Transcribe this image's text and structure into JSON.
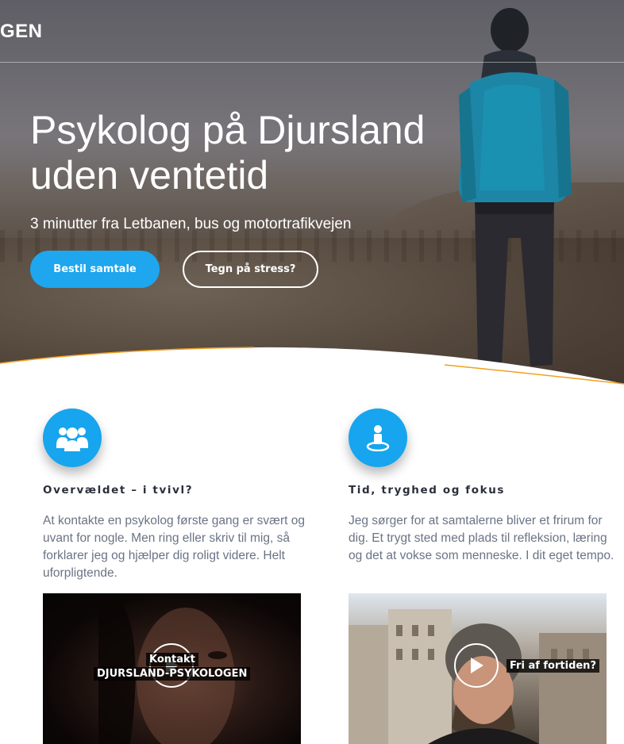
{
  "header": {
    "logo_text": "GEN"
  },
  "hero": {
    "title_line1": "Psykolog på Djursland",
    "title_line2": "uden ventetid",
    "subtitle": "3 minutter fra Letbanen, bus og motortrafikvejen",
    "primary_button": "Bestil samtale",
    "secondary_button": "Tegn på stress?"
  },
  "features": [
    {
      "icon": "users-group-icon",
      "title": "Overvældet – i tvivl?",
      "text": "At kontakte en psykolog første gang er svært og uvant for nogle. Men ring eller skriv til mig, så forklarer jeg og hjælper dig roligt videre. Helt uforpligtende."
    },
    {
      "icon": "person-on-spot-icon",
      "title": "Tid, tryghed og fokus",
      "text": "Jeg sørger for at samtalerne bliver et frirum for dig. Et trygt sted med plads til refleksion, læring og det at vokse som menneske. I dit eget tempo."
    }
  ],
  "videos": [
    {
      "label_line1": "Kontakt",
      "label_line2": "DJURSLAND-PSYKOLOGEN"
    },
    {
      "label_line1": "Fri af fortiden?"
    }
  ],
  "colors": {
    "accent_blue": "#1ea6ee",
    "curve_orange": "#f0a020",
    "heading_dark": "#2a2f3a",
    "body_gray": "#6a7385"
  }
}
